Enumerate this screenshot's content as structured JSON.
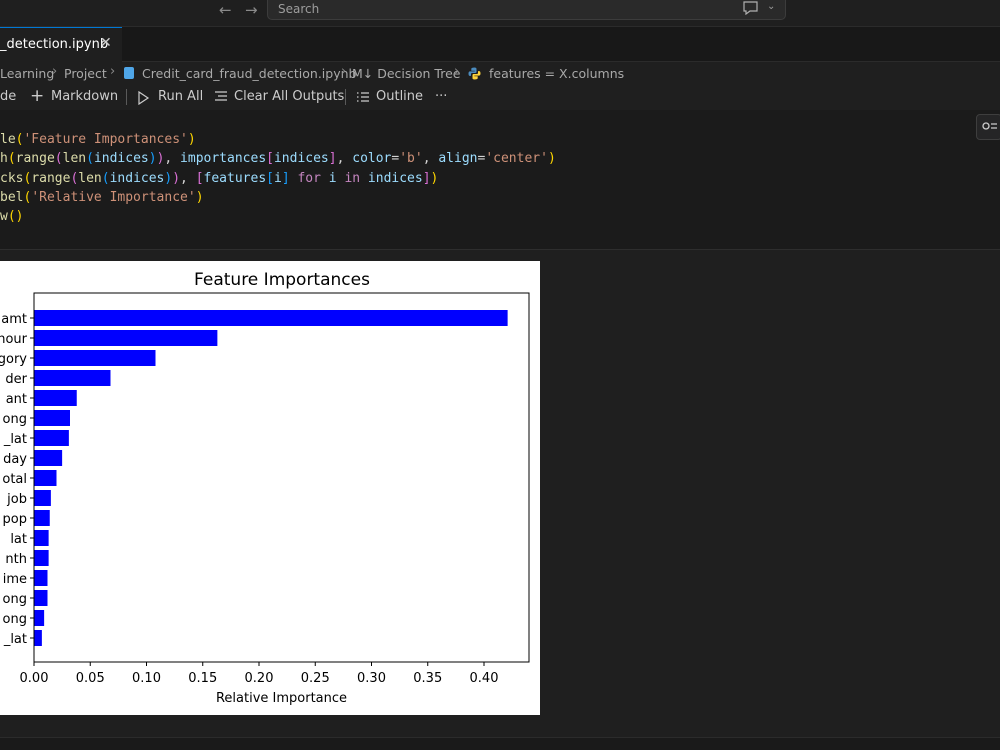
{
  "titlebar": {
    "search_placeholder": "Search"
  },
  "tab": {
    "label": "_detection.ipynb"
  },
  "breadcrumb": {
    "items": [
      "Learning",
      "Project",
      "Credit_card_fraud_detection.ipynb",
      "M↓ Decision Tree",
      "features = X.columns"
    ]
  },
  "toolbar": {
    "code_label": "de",
    "markdown_label": "Markdown",
    "run_all_label": "Run All",
    "clear_outputs_label": "Clear All Outputs",
    "outline_label": "Outline",
    "more_label": "···"
  },
  "code": {
    "lines": [
      "le('Feature Importances')",
      "h(range(len(indices)), importances[indices], color='b', align='center')",
      "cks(range(len(indices)), [features[i] for i in indices])",
      "bel('Relative Importance')",
      "w()"
    ]
  },
  "colors": {
    "bar": "#0000ff",
    "accent": "#0078d4"
  },
  "chart_data": {
    "type": "bar",
    "orientation": "horizontal",
    "title": "Feature Importances",
    "xlabel": "Relative Importance",
    "ylabel": "",
    "xlim": [
      0,
      0.44
    ],
    "xticks": [
      0.0,
      0.05,
      0.1,
      0.15,
      0.2,
      0.25,
      0.3,
      0.35,
      0.4
    ],
    "xtick_labels": [
      "0.00",
      "0.05",
      "0.10",
      "0.15",
      "0.20",
      "0.25",
      "0.30",
      "0.35",
      "0.40"
    ],
    "categories": [
      "amt",
      "hour",
      "gory",
      "der",
      "ant",
      "ong",
      "_lat",
      "day",
      "otal",
      "job",
      "pop",
      "lat",
      "nth",
      "ime",
      "ong",
      "ong",
      "_lat"
    ],
    "values": [
      0.421,
      0.163,
      0.108,
      0.068,
      0.038,
      0.032,
      0.031,
      0.025,
      0.02,
      0.015,
      0.014,
      0.013,
      0.013,
      0.012,
      0.012,
      0.009,
      0.007
    ],
    "grid": false
  }
}
